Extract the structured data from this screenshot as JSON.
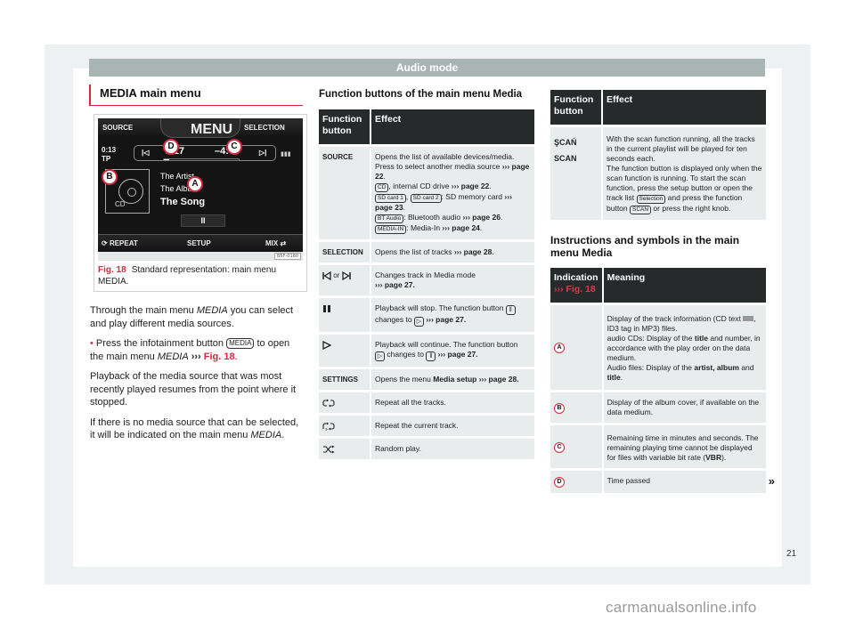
{
  "header": {
    "title": "Audio mode"
  },
  "page_number": "21",
  "watermark": "carmanualsonline.info",
  "left": {
    "section_title": "MEDIA main menu",
    "figure": {
      "screen": {
        "source": "SOURCE",
        "menu": "MENU",
        "selection": "SELECTION",
        "clock": "0:13",
        "tp": "TP",
        "elapsed": "0:17",
        "remaining": "–4:00",
        "artist": "The Artist",
        "album": "The Album",
        "song": "The Song",
        "cd_label": "CD",
        "repeat": "REPEAT",
        "setup": "SETUP",
        "mix": "MIX",
        "callouts": [
          "A",
          "B",
          "C",
          "D"
        ],
        "pause_glyph": "II",
        "progress_fraction": 0.07
      },
      "code": "B5F-0160",
      "caption_ref": "Fig. 18",
      "caption_text": "Standard representation: main menu MEDIA."
    },
    "paragraphs": {
      "p1_a": "Through the main menu ",
      "p1_em": "MEDIA",
      "p1_b": " you can se­lect and play different media sources.",
      "p2_a": "Press the infotainment button ",
      "p2_key": "MEDIA",
      "p2_b": " to open the main menu ",
      "p2_em": "MEDIA",
      "p2_arrow": " ››› ",
      "p2_ref": "Fig. 18",
      "p2_end": ".",
      "p3": "Playback of the media source that was most recently played resumes from the point where it stopped.",
      "p4_a": "If there is no media source that can be selec­ted, it will be indicated on the main menu ",
      "p4_em": "MEDIA",
      "p4_end": "."
    }
  },
  "function_table": {
    "title": "Function buttons of the main menu Media",
    "headers": [
      "Function button",
      "Effect"
    ],
    "rows": {
      "source": {
        "button": "SOURCE",
        "t1": "Opens the list of available devices/media. Press to select another media source ",
        "p1": "››› page 22",
        "cd": "CD",
        "t2": ", internal CD drive ",
        "p2": "››› page 22",
        "sd1": "SD card 1",
        "sd2": "SD card 2",
        "t3": ": SD memory card ",
        "p3": "››› page 23",
        "bt": "BT Audio",
        "t4": ": Bluetooth audio ",
        "p4": "››› page 26",
        "mi": "MEDIA-IN",
        "t5": ": Media-In ",
        "p5": "››› page 24"
      },
      "selection": {
        "button": "SELECTION",
        "text": "Opens the list of tracks ",
        "page": "››› page 28."
      },
      "skip": {
        "button_or": "or",
        "icons": [
          "skip-back-icon",
          "skip-forward-icon"
        ],
        "text": "Changes track in Media mode ",
        "page": "››› page 27."
      },
      "pause": {
        "icon": "pause-icon",
        "t1": "Playback will stop. The function button ",
        "t2": " changes to ",
        "page": " ››› page 27."
      },
      "play": {
        "icon": "play-icon",
        "t1": "Playback will continue. The function button ",
        "t2": " changes to ",
        "page": " ››› page 27."
      },
      "settings": {
        "button": "SETTINGS",
        "t1": "Opens the menu ",
        "bold": "Media setup",
        "page": " ››› page 28."
      },
      "repeat_all": {
        "icon": "repeat-all-icon",
        "text": "Repeat all the tracks."
      },
      "repeat_one": {
        "icon": "repeat-one-icon",
        "text": "Repeat the current track."
      },
      "shuffle": {
        "icon": "shuffle-icon",
        "text": "Random play."
      }
    }
  },
  "scan_table": {
    "headers": [
      "Function button",
      "Effect"
    ],
    "row": {
      "btn1": "ŞCAŃ",
      "btn2": "SCAN",
      "t1": "With the scan function running, all the tracks in the current playlist will be played for ten seconds each.",
      "t2": "The function button is displayed only when the scan function is running. To start the scan function, press the setup button or open the track list ",
      "key1": "Selection",
      "t3": " and press the function button ",
      "key2": "SCAN",
      "t4": " or press the right knob."
    }
  },
  "indication_table": {
    "title": "Instructions and symbols in the main menu Media",
    "headers": {
      "col1": "Indication",
      "col1_ref": "››› Fig. 18",
      "col2": "Meaning"
    },
    "rows": [
      {
        "label": "A",
        "t1": "Display of the track information (CD text ",
        "t2": ", ID3 tag in MP3) files.",
        "t3": "audio CDs: Display of the ",
        "b1": "title",
        "t4": " and num­ber, in accordance with the play order on the data medium.",
        "t5": "Audio files: Display of the ",
        "b2": "artist, album",
        "t6": " and ",
        "b3": "title",
        "t7": "."
      },
      {
        "label": "B",
        "text": "Display of the album cover, if available on the data medium."
      },
      {
        "label": "C",
        "t1": "Remaining time in minutes and sec­onds. The remaining playing time can­not be displayed for files with variable bit rate (",
        "b": "VBR",
        "t2": ")."
      },
      {
        "label": "D",
        "text": "Time passed",
        "continue": "»"
      }
    ]
  }
}
